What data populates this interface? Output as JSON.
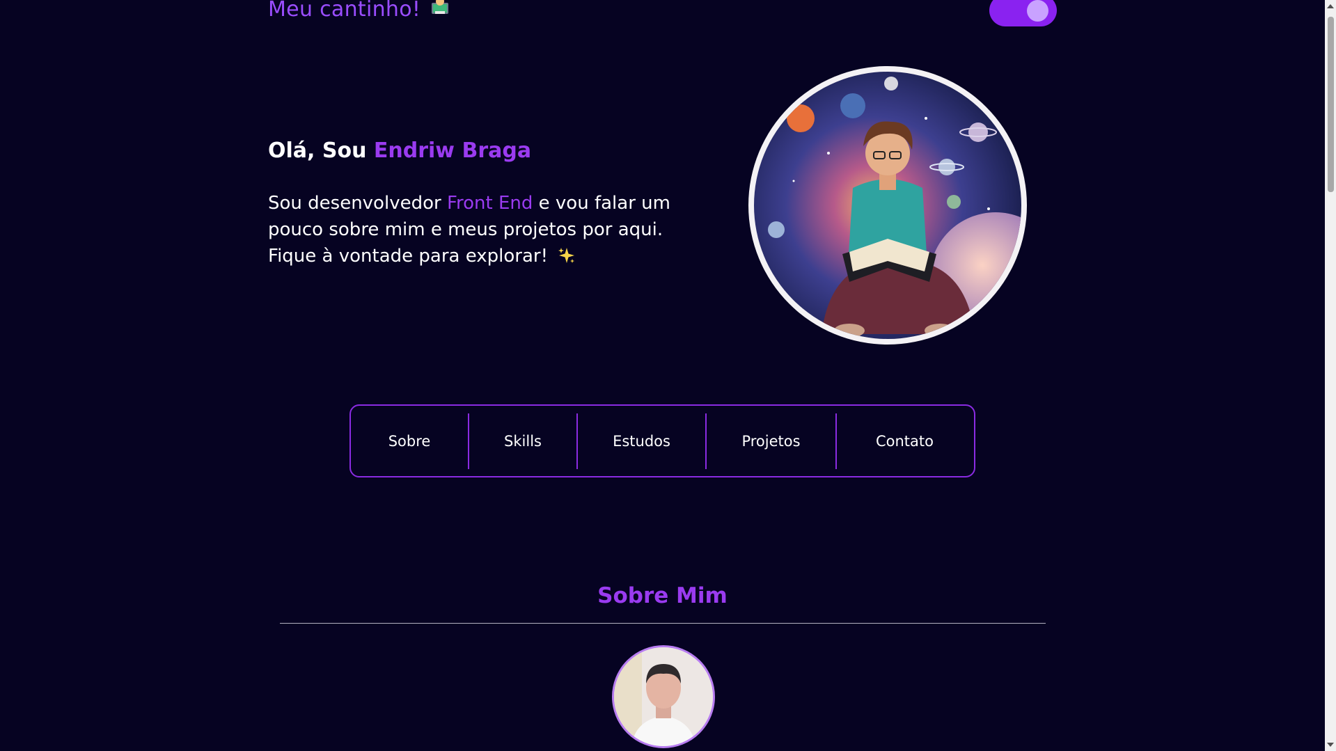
{
  "header": {
    "brand_text": "Meu cantinho!",
    "brand_icon": "technologist-emoji-icon",
    "toggle_icon": "theme-toggle-icon"
  },
  "hero": {
    "greeting": "Olá, Sou ",
    "name": "Endriw Braga",
    "text_1": "Sou desenvolvedor ",
    "text_accent": "Front End",
    "text_2": " e vou falar um pouco sobre mim e meus projetos por aqui. Fique à vontade para explorar!",
    "sparkle_icon": "sparkles-icon"
  },
  "nav": {
    "items": [
      {
        "label": "Sobre"
      },
      {
        "label": "Skills"
      },
      {
        "label": "Estudos"
      },
      {
        "label": "Projetos"
      },
      {
        "label": "Contato"
      }
    ]
  },
  "about": {
    "title": "Sobre Mim"
  },
  "colors": {
    "background": "#060322",
    "accent": "#9a3bf0",
    "toggle": "#8a22f0",
    "nav_border": "#8a2be2"
  }
}
